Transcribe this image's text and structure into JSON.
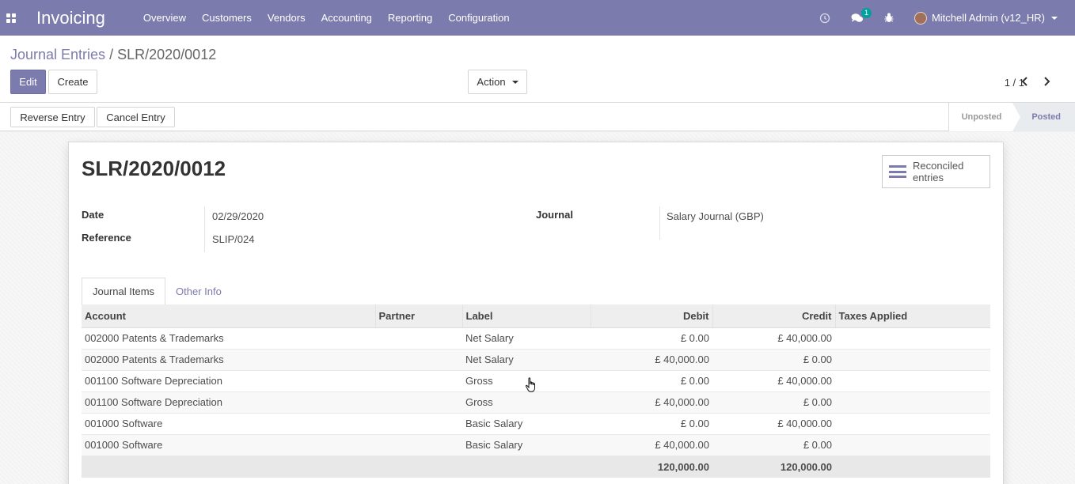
{
  "navbar": {
    "brand": "Invoicing",
    "menu": [
      "Overview",
      "Customers",
      "Vendors",
      "Accounting",
      "Reporting",
      "Configuration"
    ],
    "chat_badge": "1",
    "user": "Mitchell Admin (v12_HR)"
  },
  "control_panel": {
    "breadcrumb_parent": "Journal Entries",
    "breadcrumb_sep": "/",
    "breadcrumb_current": "SLR/2020/0012",
    "edit_label": "Edit",
    "create_label": "Create",
    "action_label": "Action",
    "pager": "1 / 1"
  },
  "header": {
    "reverse_label": "Reverse Entry",
    "cancel_label": "Cancel Entry",
    "status": {
      "unposted": "Unposted",
      "posted": "Posted",
      "current": "Posted"
    }
  },
  "form": {
    "title": "SLR/2020/0012",
    "smart_button": {
      "line1": "Reconciled",
      "line2": "entries"
    },
    "date_label": "Date",
    "date_value": "02/29/2020",
    "reference_label": "Reference",
    "reference_value": "SLIP/024",
    "journal_label": "Journal",
    "journal_value": "Salary Journal (GBP)"
  },
  "tabs": {
    "journal_items": "Journal Items",
    "other_info": "Other Info"
  },
  "table": {
    "headers": {
      "account": "Account",
      "partner": "Partner",
      "label": "Label",
      "debit": "Debit",
      "credit": "Credit",
      "taxes": "Taxes Applied"
    },
    "rows": [
      {
        "account": "002000 Patents & Trademarks",
        "partner": "",
        "label": "Net Salary",
        "debit": "£ 0.00",
        "credit": "£ 40,000.00",
        "taxes": ""
      },
      {
        "account": "002000 Patents & Trademarks",
        "partner": "",
        "label": "Net Salary",
        "debit": "£ 40,000.00",
        "credit": "£ 0.00",
        "taxes": ""
      },
      {
        "account": "001100 Software Depreciation",
        "partner": "",
        "label": "Gross",
        "debit": "£ 0.00",
        "credit": "£ 40,000.00",
        "taxes": ""
      },
      {
        "account": "001100 Software Depreciation",
        "partner": "",
        "label": "Gross",
        "debit": "£ 40,000.00",
        "credit": "£ 0.00",
        "taxes": ""
      },
      {
        "account": "001000 Software",
        "partner": "",
        "label": "Basic Salary",
        "debit": "£ 0.00",
        "credit": "£ 40,000.00",
        "taxes": ""
      },
      {
        "account": "001000 Software",
        "partner": "",
        "label": "Basic Salary",
        "debit": "£ 40,000.00",
        "credit": "£ 0.00",
        "taxes": ""
      }
    ],
    "total_debit": "120,000.00",
    "total_credit": "120,000.00"
  },
  "colors": {
    "brand": "#7c7bad",
    "header_bg": "#eeeeee"
  }
}
